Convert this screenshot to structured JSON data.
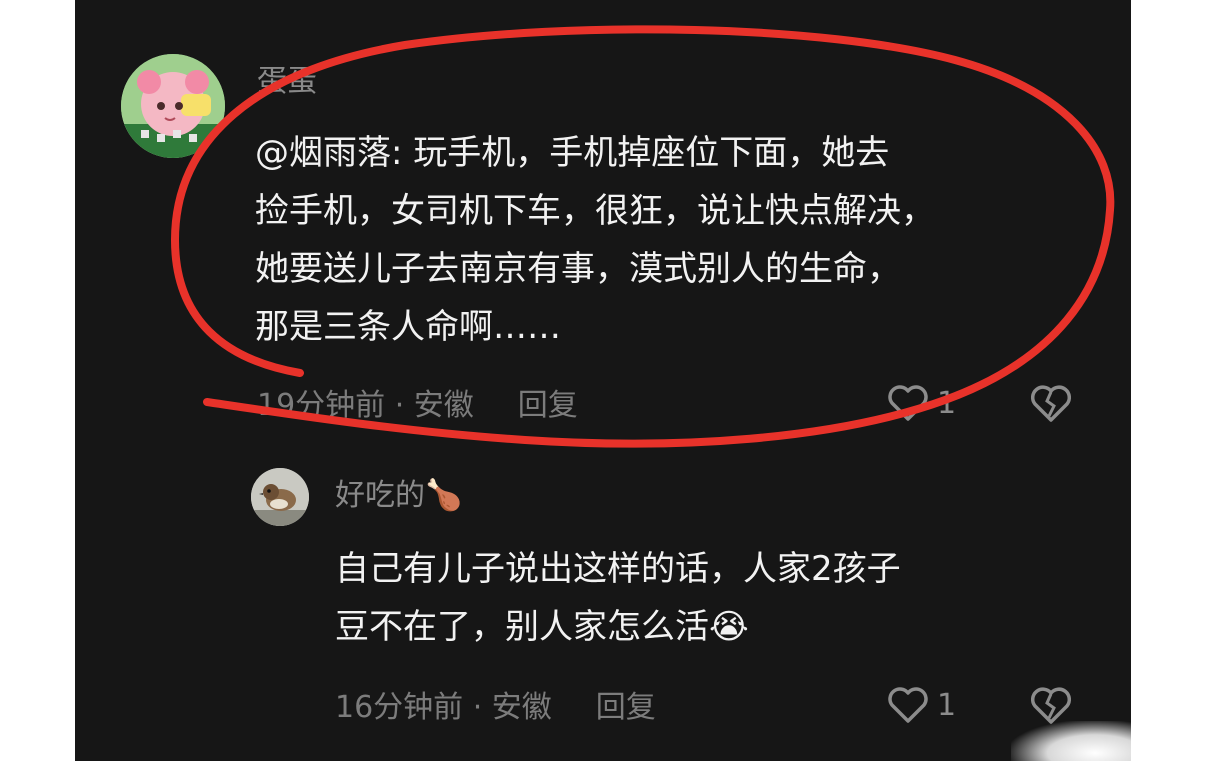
{
  "comments": [
    {
      "username": "蛋蛋",
      "lines": [
        "@烟雨落: 玩手机，手机掉座位下面，她去",
        "捡手机，女司机下车，很狂，说让快点解决，",
        "她要送儿子去南京有事，漠式别人的生命，",
        "那是三条人命啊……"
      ],
      "meta": "19分钟前 · 安徽",
      "reply_label": "回复",
      "like_count": "1"
    },
    {
      "username": "好吃的",
      "username_emoji": "🍗",
      "lines": [
        "自己有儿子说出这样的话，人家2孩子",
        "豆不在了，别人家怎么活"
      ],
      "text_emoji": "😭",
      "meta": "16分钟前 · 安徽",
      "reply_label": "回复",
      "like_count": "1"
    }
  ],
  "colors": {
    "background": "#161616",
    "annotation": "#e8322a"
  }
}
